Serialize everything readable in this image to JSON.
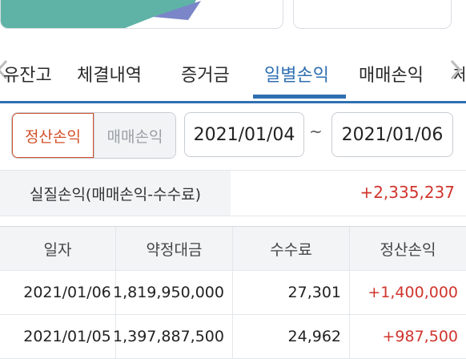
{
  "tabs": [
    {
      "label": "유잔고"
    },
    {
      "label": "체결내역"
    },
    {
      "label": "증거금"
    },
    {
      "label": "일별손익"
    },
    {
      "label": "매매손익"
    },
    {
      "label": "체"
    }
  ],
  "active_tab": "일별손익",
  "filter": {
    "segment_active": "정산손익",
    "segment_inactive": "매매손익",
    "date_from": "2021/01/04",
    "separator": "~",
    "date_to": "2021/01/06"
  },
  "summary": {
    "label": "실질손익(매매손익-수수료)",
    "value": "+2,335,237"
  },
  "table": {
    "headers": [
      "일자",
      "약정대금",
      "수수료",
      "정산손익"
    ],
    "rows": [
      [
        "2021/01/06",
        "1,819,950,000",
        "27,301",
        "+1,400,000"
      ],
      [
        "2021/01/05",
        "1,397,887,500",
        "24,962",
        "+987,500"
      ]
    ]
  },
  "colors": {
    "accent": "#2f6fb1",
    "positive": "#d0342c",
    "segment_active": "#d4502a"
  }
}
